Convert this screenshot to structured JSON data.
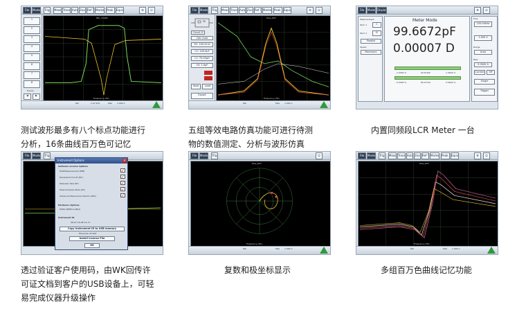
{
  "common": {
    "file": "File",
    "mode": "Mode",
    "trig": "Trig",
    "min": "Min",
    "max": "Max",
    "voltage": "1.000 V",
    "freq_unit": "Frequency (Hz)"
  },
  "tiles": [
    {
      "id": "tile1",
      "caption_lines": [
        "测试波形最多有八个标点功能进行",
        "分析，16条曲线百万色可记忆"
      ],
      "toolbar": [
        "Meas Setup",
        "Trace Setup",
        "Auto Fit",
        "Zoom",
        "Ref Trace",
        "Markers",
        "Peak Search",
        "Equiv Ckt"
      ],
      "markers": [
        "1",
        "2",
        "3",
        "4",
        "5",
        "6",
        "7",
        "8"
      ],
      "marker_footer": "Traces",
      "plot_title": "P8c_15928",
      "min_value": "1.07 kHz",
      "max_value": "1.000 V"
    },
    {
      "id": "tile2",
      "caption_lines": [
        "五组等效电路仿真功能可进行待测",
        "物的数值测定、分析与波形仿真"
      ],
      "toolbar": [
        "Meas Setup",
        "Trace Setup",
        "Auto Fit",
        "Zoom",
        "Ref Trace",
        "Markers",
        "Peak Search",
        "Equiv Ckt"
      ],
      "plot_title": "Plus_DUT",
      "params": [
        "R1: 100.00 Ω",
        "C1: 100.0pF",
        "L1: 70.00μH",
        "C0: 1.0pF"
      ],
      "buttons": [
        "Circuit D",
        "Calc Auto",
        "Save",
        "Load",
        "Export"
      ]
    },
    {
      "id": "tile3",
      "caption_lines": [
        "内置同频段LCR Meter 一台"
      ],
      "title": "Meter Mode",
      "measurement_label": "Measurement",
      "term1_label": "Term 1",
      "term1_value": "C",
      "term2_label": "Term 2",
      "term2_value": "D",
      "parallel": "Parallel",
      "speed_label": "Speed",
      "speed_value": "Maximum",
      "primary": "99.6672pF",
      "secondary": "0.00007 D",
      "freq_label": "Freq",
      "freq_value": "100.00kHz",
      "level_value": "1.000 V",
      "range_label": "Range",
      "range_value": "Auto",
      "bias_label": "Bias",
      "bias_value": "0.0000 A",
      "current_label": "Current",
      "off_label": "Off",
      "single_label": "Single",
      "trigger_label": "Trigger",
      "scale1": [
        "-1.0000 %",
        "99.672pF",
        "1.0000 %"
      ],
      "scale2": [
        "-5.0000 %",
        "80.07%Ω",
        "5.0000 %"
      ]
    },
    {
      "id": "tile4",
      "caption_lines": [
        "透过验证客户使用码，由WK回传许",
        "可证文档到客户的USB设备上，可轻",
        "易完成仪器升级操作"
      ],
      "dialog_title": "Instrument Options",
      "license_heading": "Software License Options",
      "licenses": [
        "MultiMeasurement (MM)",
        "Equivalent Circuit (EC)",
        "Piezoelec Test (PT)",
        "Polar/Complex Plots (PC)",
        "Advanced Resonance Search (ARS)"
      ],
      "hardware_heading": "Hardware Options",
      "hardware_value": "6565-16MHz-LAN(1)",
      "instrument_heading": "Instrument ID",
      "instrument_value": "06-07-10-0E-11-71",
      "copy_button": "Copy Instrument ID to USB memory",
      "filename": "Filename: ID.DAT",
      "install_button": "Install License File",
      "ok_button": "OK"
    },
    {
      "id": "tile5",
      "caption_lines": [
        "复数和极坐标显示"
      ],
      "plot_title": "Plus_DUT"
    },
    {
      "id": "tile6",
      "caption_lines": [
        "多组百万色曲线记忆功能"
      ],
      "plot_title": "Plus_DUT"
    }
  ],
  "colors": {
    "plot_bg": "#000000",
    "grid": "#3a4a3a",
    "trace_green": "#7bdc5a",
    "trace_yellow": "#f0c528",
    "trace_red": "#e04b4b",
    "trace_white": "#e8e8e8",
    "accent_green": "#2e9a3c"
  }
}
